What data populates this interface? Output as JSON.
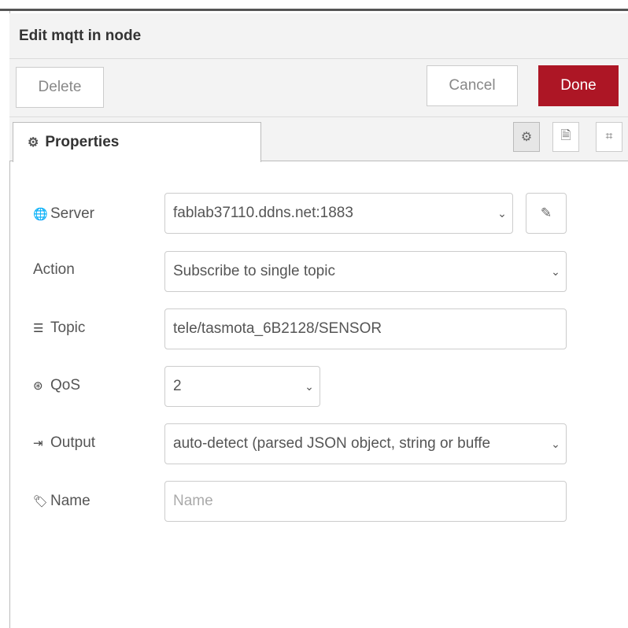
{
  "window": {
    "title": "Edit mqtt in node"
  },
  "toolbar": {
    "delete_label": "Delete",
    "cancel_label": "Cancel",
    "done_label": "Done",
    "done_color": "#ad1625"
  },
  "tabs": {
    "properties_label": "Properties"
  },
  "form": {
    "server": {
      "label": "Server",
      "value": "fablab37110.ddns.net:1883"
    },
    "action": {
      "label": "Action",
      "value": "Subscribe to single topic"
    },
    "topic": {
      "label": "Topic",
      "value": "tele/tasmota_6B2128/SENSOR"
    },
    "qos": {
      "label": "QoS",
      "value": "2"
    },
    "output": {
      "label": "Output",
      "value": "auto-detect (parsed JSON object, string or buffe"
    },
    "name": {
      "label": "Name",
      "value": "",
      "placeholder": "Name"
    }
  },
  "icons": [
    "cog-icon",
    "globe-icon",
    "tasks-icon",
    "qos-icon",
    "sign-out-icon",
    "tag-icon",
    "pencil-icon",
    "chevron-down-icon",
    "description-icon",
    "appearance-icon"
  ]
}
